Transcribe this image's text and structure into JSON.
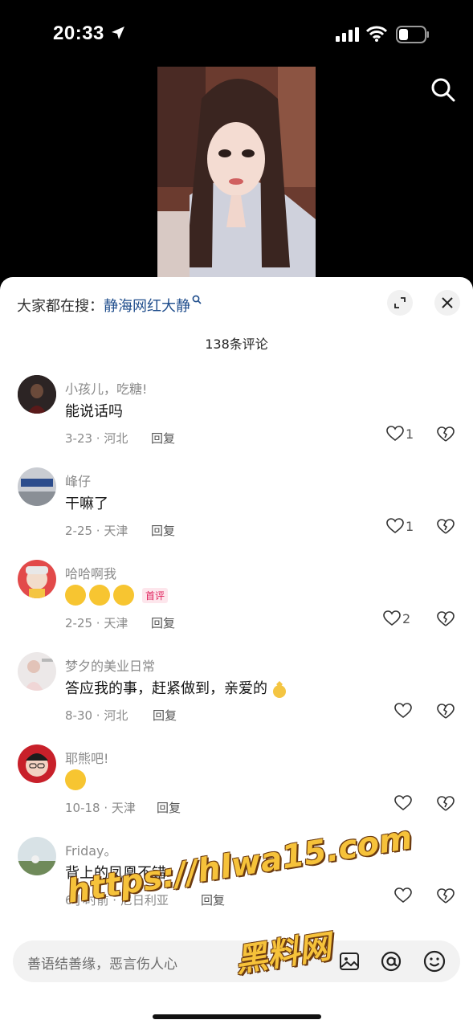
{
  "status_bar": {
    "time": "20:33"
  },
  "sheet": {
    "hot_search_prefix": "大家都在搜：",
    "hot_search_keyword": "静海网红大静",
    "comment_count": "138条评论"
  },
  "comments": [
    {
      "user": "小孩儿，吃糖!",
      "text": "能说话吗",
      "meta": "3-23 · 河北",
      "reply": "回复",
      "likes": "1"
    },
    {
      "user": "峰仔",
      "text": "干嘛了",
      "meta": "2-25 · 天津",
      "reply": "回复",
      "likes": "1"
    },
    {
      "user": "哈哈啊我",
      "text": "",
      "badge": "首评",
      "meta": "2-25 · 天津",
      "reply": "回复",
      "likes": "2"
    },
    {
      "user": "梦夕的美业日常",
      "text": "答应我的事，赶紧做到，亲爱的",
      "meta": "8-30 · 河北",
      "reply": "回复",
      "likes": ""
    },
    {
      "user": "耶熊吧!",
      "text": "",
      "meta": "10-18 · 天津",
      "reply": "回复",
      "likes": ""
    },
    {
      "user": "Friday。",
      "text": "背上的凤凰不错",
      "meta": "6小时前 · 尼日利亚",
      "reply": "回复",
      "likes": ""
    }
  ],
  "input": {
    "placeholder": "善语结善缘，恶言伤人心"
  },
  "watermark": {
    "url": "https://hlwa15.com",
    "name": "黑料网"
  },
  "icons": [
    "location-arrow-icon",
    "signal-icon",
    "wifi-icon",
    "battery-icon",
    "search-icon",
    "expand-icon",
    "close-icon",
    "heart-icon",
    "broken-heart-icon",
    "image-icon",
    "at-icon",
    "emoji-icon"
  ]
}
